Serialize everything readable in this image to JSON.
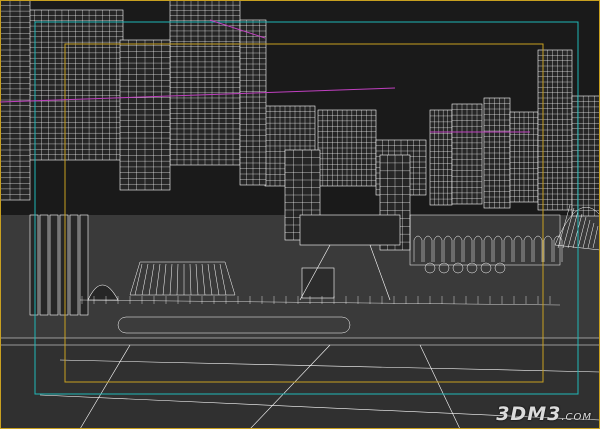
{
  "viewport": {
    "background": "#202020",
    "sky_color": "#1a1a1a",
    "wire_color": "#ffffff",
    "ground_color": "#3a3a3a",
    "road_color": "#303030",
    "safe_frame_outer_color": "#1fb7b7",
    "safe_frame_inner_color": "#c8a020",
    "guide_line_color": "#c040c0",
    "watermark_color": "#dcdcdc"
  },
  "watermark": {
    "main": "3DM3",
    "suffix": ".COM"
  }
}
